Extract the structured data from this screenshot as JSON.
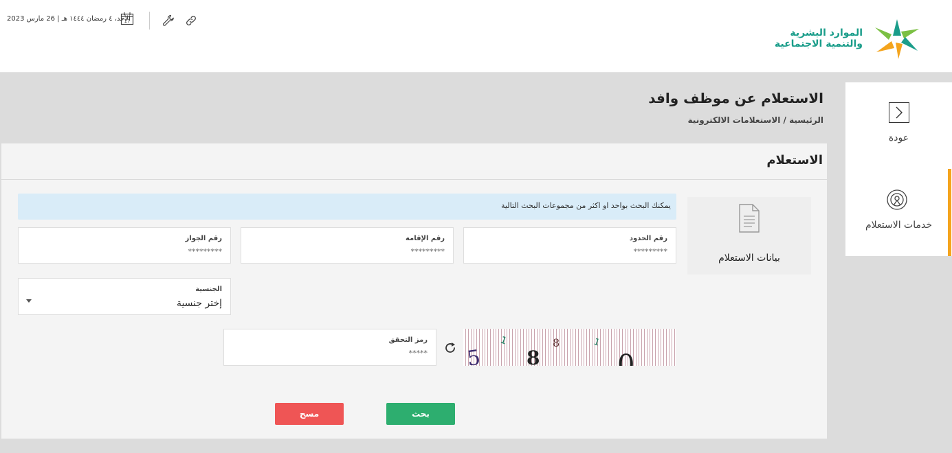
{
  "header": {
    "org_line1": "الموارد البشرية",
    "org_line2": "والتنمية الاجتماعية",
    "date": "الأحد، ٤ رمضان ١٤٤٤ هـ | 26 مارس 2023",
    "calendar_day": "17"
  },
  "sidebar": {
    "back_label": "عودة",
    "services_label": "خدمات الاستعلام"
  },
  "page": {
    "title": "الاستعلام عن موظف وافد",
    "breadcrumb": "الرئيسية / الاستعلامات الالكترونية"
  },
  "card": {
    "title": "الاستعلام",
    "data_section_label": "بيانات الاستعلام",
    "info_text": "يمكنك البحث بواحد او اكثر من مجموعات البحث التالية"
  },
  "fields": {
    "border_number": {
      "label": "رقم الحدود",
      "placeholder": "*********"
    },
    "iqama_number": {
      "label": "رقم الإقامة",
      "placeholder": "*********"
    },
    "passport_number": {
      "label": "رقم الجواز",
      "placeholder": "*********"
    },
    "nationality": {
      "label": "الجنسية",
      "selected": "إختر جنسية"
    },
    "captcha": {
      "label": "رمز التحقق",
      "placeholder": "*****"
    }
  },
  "buttons": {
    "search_label": "بحث",
    "clear_label": "مسح"
  },
  "colors": {
    "brand_teal": "#1a9d8a",
    "accent_orange": "#f4a41d",
    "search_green": "#2dae6f",
    "clear_red": "#ef5555",
    "info_blue": "#d9ecf8"
  }
}
